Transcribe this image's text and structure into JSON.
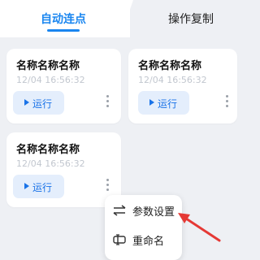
{
  "tabs": {
    "auto_click": "自动连点",
    "operation_copy": "操作复制"
  },
  "cards": [
    {
      "title": "名称名称名称",
      "time": "12/04 16:56:32",
      "run_label": "运行"
    },
    {
      "title": "名称名称名称",
      "time": "12/04 16:56:32",
      "run_label": "运行"
    },
    {
      "title": "名称名称名称",
      "time": "12/04 16:56:32",
      "run_label": "运行"
    }
  ],
  "context_menu": {
    "params": "参数设置",
    "rename": "重命名"
  },
  "colors": {
    "accent": "#1a86f0",
    "background": "#eef0f4",
    "arrow": "#e53935"
  }
}
